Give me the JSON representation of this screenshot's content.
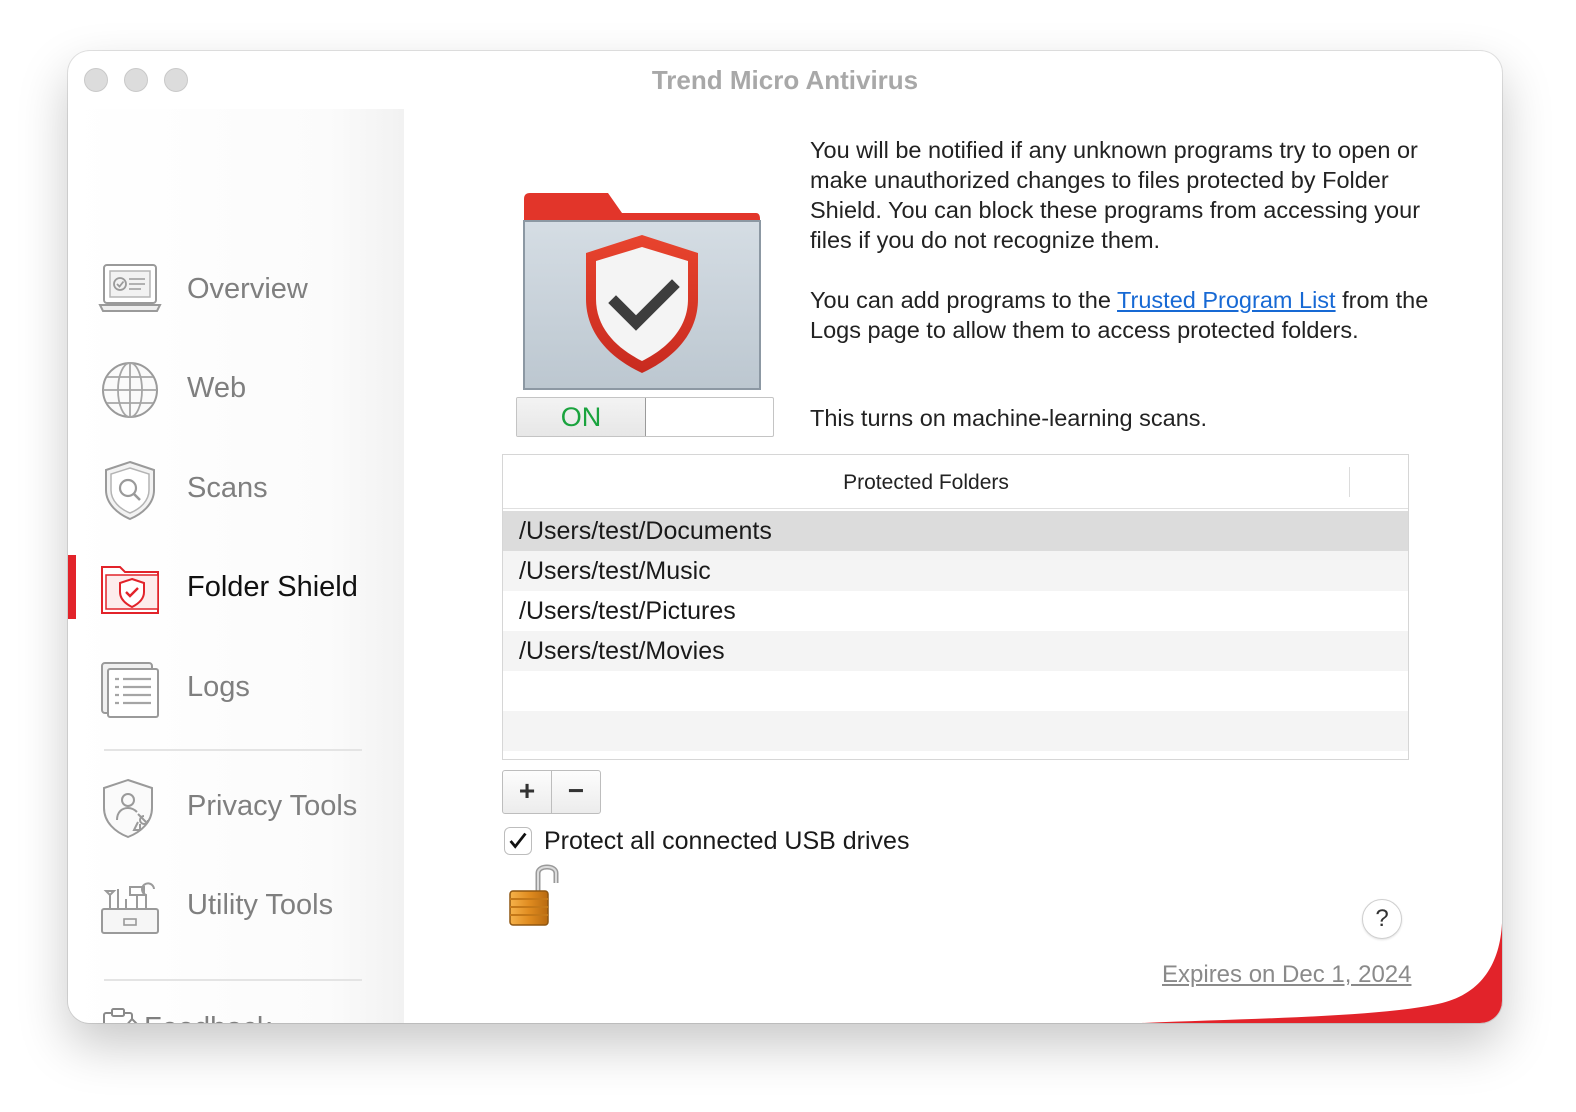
{
  "window": {
    "title": "Trend Micro Antivirus"
  },
  "sidebar": {
    "items": [
      {
        "label": "Overview",
        "icon": "overview-icon"
      },
      {
        "label": "Web",
        "icon": "globe-icon"
      },
      {
        "label": "Scans",
        "icon": "shield-scan-icon"
      },
      {
        "label": "Folder Shield",
        "icon": "folder-shield-icon",
        "active": true
      },
      {
        "label": "Logs",
        "icon": "logs-icon"
      },
      {
        "label": "Privacy Tools",
        "icon": "privacy-tools-icon"
      },
      {
        "label": "Utility Tools",
        "icon": "utility-tools-icon"
      }
    ],
    "feedback": {
      "label": "Feedback",
      "icon": "feedback-icon"
    }
  },
  "folder_shield": {
    "toggle_state": "ON",
    "description": {
      "p1": "You will be notified if any unknown programs try to open or make unauthorized changes to files protected by Folder Shield. You can block these programs from accessing your files if you do not recognize them.",
      "p2_prefix": "You can add programs to the ",
      "p2_link": "Trusted Program List",
      "p2_suffix": " from the Logs page to allow them to access protected folders.",
      "p3": "This turns on machine-learning scans."
    },
    "table": {
      "header": "Protected Folders",
      "rows": [
        "/Users/test/Documents",
        "/Users/test/Music",
        "/Users/test/Pictures",
        "/Users/test/Movies"
      ],
      "selected_index": 0
    },
    "add_label": "+",
    "remove_label": "−",
    "usb": {
      "label": "Protect all connected USB drives",
      "checked": true
    }
  },
  "footer": {
    "help_label": "?",
    "expires": "Expires on Dec 1, 2024"
  },
  "colors": {
    "accent_red": "#e2232a",
    "link_blue": "#1769d4",
    "on_green": "#1aa33e"
  }
}
